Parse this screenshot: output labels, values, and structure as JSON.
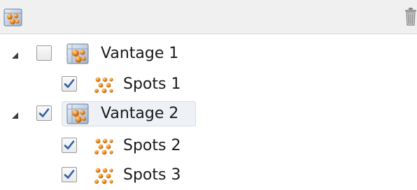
{
  "toolbar": {
    "left_icon": "vantage-group-icon",
    "right_icon": "trash-icon"
  },
  "tree": {
    "nodes": [
      {
        "label": "Vantage 1",
        "checked": false,
        "expanded": true,
        "icon": "vantage-icon"
      },
      {
        "label": "Spots 1",
        "checked": true,
        "icon": "spots-icon"
      },
      {
        "label": "Vantage 2",
        "checked": true,
        "expanded": true,
        "selected": true,
        "icon": "vantage-icon"
      },
      {
        "label": "Spots 2",
        "checked": true,
        "icon": "spots-icon"
      },
      {
        "label": "Spots 3",
        "checked": true,
        "icon": "spots-icon"
      }
    ]
  },
  "colors": {
    "toolbar_bg": "#f0f0f0",
    "spot_orange": "#f08a1e",
    "check_blue": "#2f5fa8",
    "selection_bg": "#eef1f5"
  }
}
